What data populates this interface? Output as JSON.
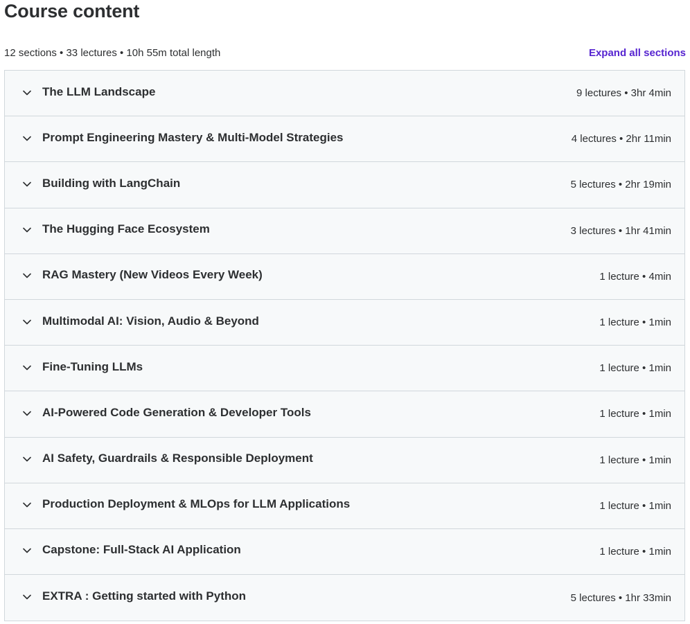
{
  "header": {
    "title": "Course content",
    "summary": "12 sections • 33 lectures • 10h 55m total length",
    "expand_label": "Expand all sections"
  },
  "colors": {
    "accent": "#5624d0",
    "text": "#2d2f31",
    "section_bg": "#f7f9fa",
    "border": "#d1d7dc"
  },
  "sections": [
    {
      "title": "The LLM Landscape",
      "meta": "9 lectures • 3hr 4min",
      "icon": "chevron-down-icon"
    },
    {
      "title": "Prompt Engineering Mastery & Multi-Model Strategies",
      "meta": "4 lectures • 2hr 11min",
      "icon": "chevron-down-icon"
    },
    {
      "title": "Building with LangChain",
      "meta": "5 lectures • 2hr 19min",
      "icon": "chevron-down-icon"
    },
    {
      "title": "The Hugging Face Ecosystem",
      "meta": "3 lectures • 1hr 41min",
      "icon": "chevron-down-icon"
    },
    {
      "title": "RAG Mastery (New Videos Every Week)",
      "meta": "1 lecture • 4min",
      "icon": "chevron-down-icon"
    },
    {
      "title": "Multimodal AI: Vision, Audio & Beyond",
      "meta": "1 lecture • 1min",
      "icon": "chevron-down-icon"
    },
    {
      "title": "Fine-Tuning LLMs",
      "meta": "1 lecture • 1min",
      "icon": "chevron-down-icon"
    },
    {
      "title": "AI-Powered Code Generation & Developer Tools",
      "meta": "1 lecture • 1min",
      "icon": "chevron-down-icon"
    },
    {
      "title": "AI Safety, Guardrails & Responsible Deployment",
      "meta": "1 lecture • 1min",
      "icon": "chevron-down-icon"
    },
    {
      "title": "Production Deployment & MLOps for LLM Applications",
      "meta": "1 lecture • 1min",
      "icon": "chevron-down-icon"
    },
    {
      "title": "Capstone: Full-Stack AI Application",
      "meta": "1 lecture • 1min",
      "icon": "chevron-down-icon"
    },
    {
      "title": "EXTRA : Getting started with Python",
      "meta": "5 lectures • 1hr 33min",
      "icon": "chevron-down-icon"
    }
  ]
}
